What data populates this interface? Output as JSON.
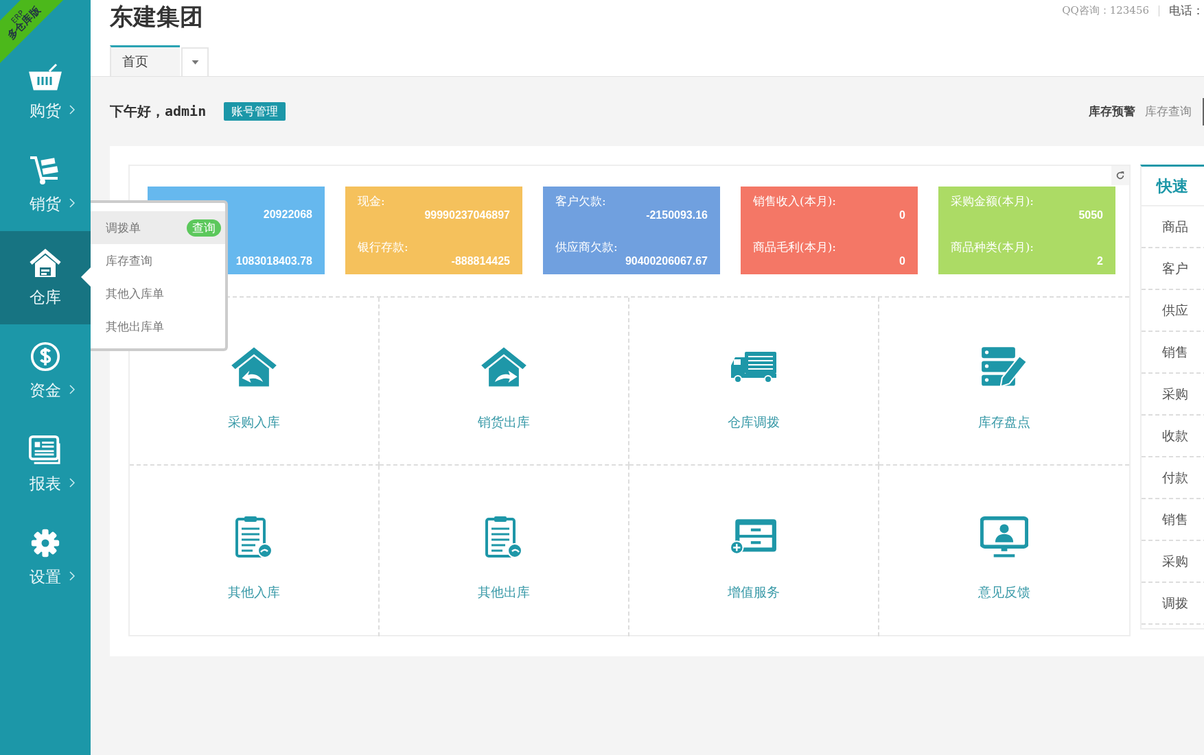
{
  "corner_ribbon": {
    "lines": [
      "ERP",
      "多仓库版"
    ]
  },
  "sidebar": {
    "items": [
      {
        "label": "购货",
        "kind": "basket",
        "selected": false
      },
      {
        "label": "销货",
        "kind": "cart",
        "selected": false
      },
      {
        "label": "仓库",
        "kind": "warehouse",
        "selected": true
      },
      {
        "label": "资金",
        "kind": "dollar",
        "selected": false
      },
      {
        "label": "报表",
        "kind": "report",
        "selected": false
      },
      {
        "label": "设置",
        "kind": "gear",
        "selected": false
      }
    ]
  },
  "flyout": {
    "items": [
      {
        "label": "调拨单",
        "selected": true,
        "badge": "查询"
      },
      {
        "label": "库存查询",
        "selected": false
      },
      {
        "label": "其他入库单",
        "selected": false
      },
      {
        "label": "其他出库单",
        "selected": false
      }
    ]
  },
  "header": {
    "title": "东建集团",
    "contact": [
      "QQ咨询：123456",
      "电话："
    ]
  },
  "tabs": [
    {
      "label": "首页",
      "selected": true
    }
  ],
  "greeting": {
    "text": "下午好，admin",
    "button": "账号管理",
    "links": [
      {
        "label": "库存预警",
        "selected": true
      },
      {
        "label": "库存查询",
        "selected": false
      }
    ]
  },
  "stats": [
    {
      "color": "#66b8ee",
      "rows": [
        {
          "value": "20922068"
        },
        {
          "value": "1083018403.78"
        }
      ]
    },
    {
      "color": "#f5c15c",
      "rows": [
        {
          "label": "现金:",
          "value": "99990237046897"
        },
        {
          "label": "银行存款:",
          "value": "-888814425"
        }
      ]
    },
    {
      "color": "#70a0df",
      "rows": [
        {
          "label": "客户欠款:",
          "value": "-2150093.16"
        },
        {
          "label": "供应商欠款:",
          "value": "90400206067.67"
        }
      ]
    },
    {
      "color": "#f47766",
      "rows": [
        {
          "label": "销售收入(本月):",
          "value": "0"
        },
        {
          "label": "商品毛利(本月):",
          "value": "0"
        }
      ]
    },
    {
      "color": "#acdb65",
      "rows": [
        {
          "label": "采购金额(本月):",
          "value": "5050"
        },
        {
          "label": "商品种类(本月):",
          "value": "2"
        }
      ]
    }
  ],
  "shortcuts": [
    {
      "label": "采购入库",
      "kind": "house-in"
    },
    {
      "label": "销货出库",
      "kind": "house-out"
    },
    {
      "label": "仓库调拨",
      "kind": "truck"
    },
    {
      "label": "库存盘点",
      "kind": "stack-pen"
    },
    {
      "label": "其他入库",
      "kind": "clipboard-in"
    },
    {
      "label": "其他出库",
      "kind": "clipboard-out"
    },
    {
      "label": "增值服务",
      "kind": "cabinet"
    },
    {
      "label": "意见反馈",
      "kind": "monitor"
    }
  ],
  "quick_panel": {
    "title": "快速",
    "items": [
      "商品",
      "客户",
      "供应",
      "销售",
      "采购",
      "收款",
      "付款",
      "销售",
      "采购",
      "调拨"
    ]
  }
}
